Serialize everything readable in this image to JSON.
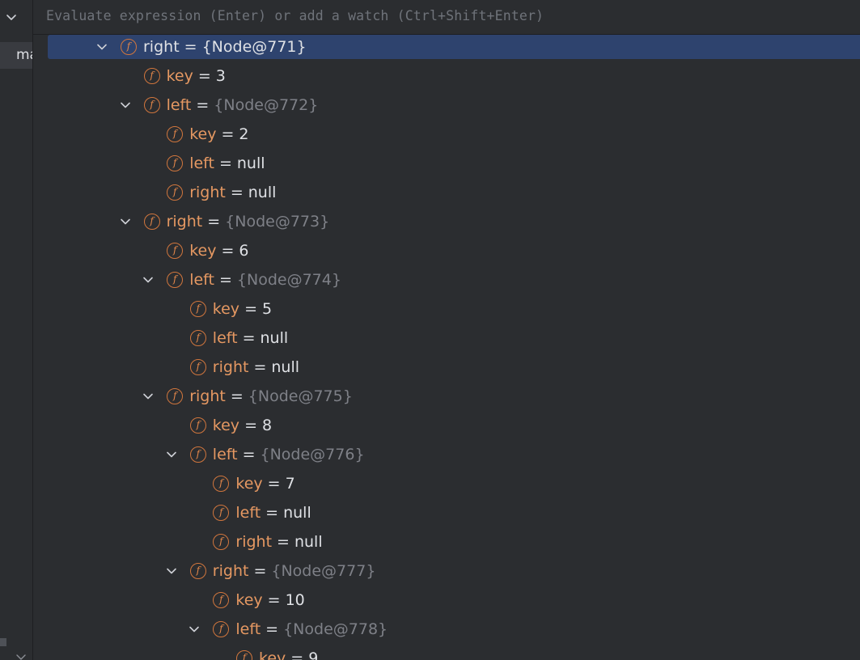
{
  "watch": {
    "placeholder": "Evaluate expression (Enter) or add a watch (Ctrl+Shift+Enter)"
  },
  "left_panel": {
    "tab_label": "ma"
  },
  "tree": [
    {
      "depth": 0,
      "expanded": true,
      "selected": true,
      "name": "right",
      "value": "{Node@771}",
      "is_object": true
    },
    {
      "depth": 1,
      "expanded": false,
      "name": "key",
      "value": "3",
      "is_object": false
    },
    {
      "depth": 1,
      "expanded": true,
      "name": "left",
      "value": "{Node@772}",
      "is_object": true
    },
    {
      "depth": 2,
      "expanded": false,
      "name": "key",
      "value": "2",
      "is_object": false
    },
    {
      "depth": 2,
      "expanded": false,
      "name": "left",
      "value": "null",
      "is_object": false
    },
    {
      "depth": 2,
      "expanded": false,
      "name": "right",
      "value": "null",
      "is_object": false
    },
    {
      "depth": 1,
      "expanded": true,
      "name": "right",
      "value": "{Node@773}",
      "is_object": true
    },
    {
      "depth": 2,
      "expanded": false,
      "name": "key",
      "value": "6",
      "is_object": false
    },
    {
      "depth": 2,
      "expanded": true,
      "name": "left",
      "value": "{Node@774}",
      "is_object": true
    },
    {
      "depth": 3,
      "expanded": false,
      "name": "key",
      "value": "5",
      "is_object": false
    },
    {
      "depth": 3,
      "expanded": false,
      "name": "left",
      "value": "null",
      "is_object": false
    },
    {
      "depth": 3,
      "expanded": false,
      "name": "right",
      "value": "null",
      "is_object": false
    },
    {
      "depth": 2,
      "expanded": true,
      "name": "right",
      "value": "{Node@775}",
      "is_object": true
    },
    {
      "depth": 3,
      "expanded": false,
      "name": "key",
      "value": "8",
      "is_object": false
    },
    {
      "depth": 3,
      "expanded": true,
      "name": "left",
      "value": "{Node@776}",
      "is_object": true
    },
    {
      "depth": 4,
      "expanded": false,
      "name": "key",
      "value": "7",
      "is_object": false
    },
    {
      "depth": 4,
      "expanded": false,
      "name": "left",
      "value": "null",
      "is_object": false
    },
    {
      "depth": 4,
      "expanded": false,
      "name": "right",
      "value": "null",
      "is_object": false
    },
    {
      "depth": 3,
      "expanded": true,
      "name": "right",
      "value": "{Node@777}",
      "is_object": true
    },
    {
      "depth": 4,
      "expanded": false,
      "name": "key",
      "value": "10",
      "is_object": false
    },
    {
      "depth": 4,
      "expanded": true,
      "name": "left",
      "value": "{Node@778}",
      "is_object": true
    },
    {
      "depth": 5,
      "expanded": false,
      "name": "key",
      "value": "9",
      "is_object": false
    }
  ],
  "icons": {
    "field_icon": "f",
    "field_icon_color": "#d1763d",
    "selection_color": "#2e436e"
  }
}
